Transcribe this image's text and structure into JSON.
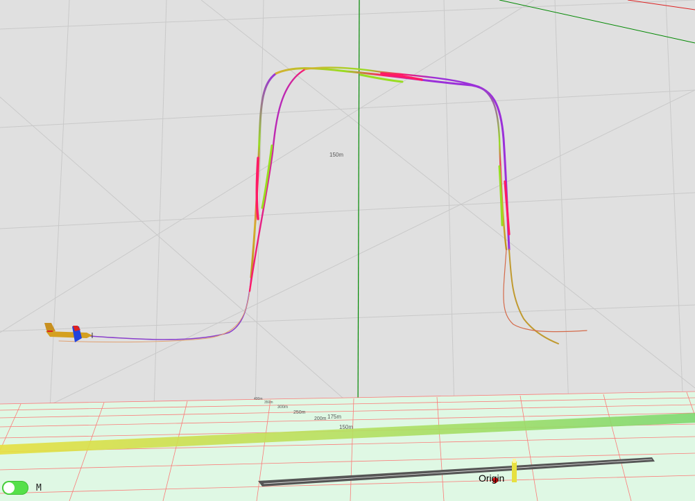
{
  "scene": {
    "vertical_distance_label": "150m",
    "ground_distance_labels": [
      "150m",
      "175m",
      "200m",
      "250m",
      "300m",
      "350m",
      "400m"
    ],
    "origin_label": "Origin"
  },
  "controls": {
    "mode_toggle_label": "M",
    "mode_toggle_on": true
  },
  "colors": {
    "background": "#e0e0e0",
    "ground": "#dff8e4",
    "ground_grid": "#ff4d4d",
    "green_axis": "#008800",
    "runway": "#555555",
    "trail_high": "#9b30d9",
    "trail_low": "#ff1a66",
    "trail_mid": "#d4b030",
    "trail_green": "#99dd22"
  }
}
